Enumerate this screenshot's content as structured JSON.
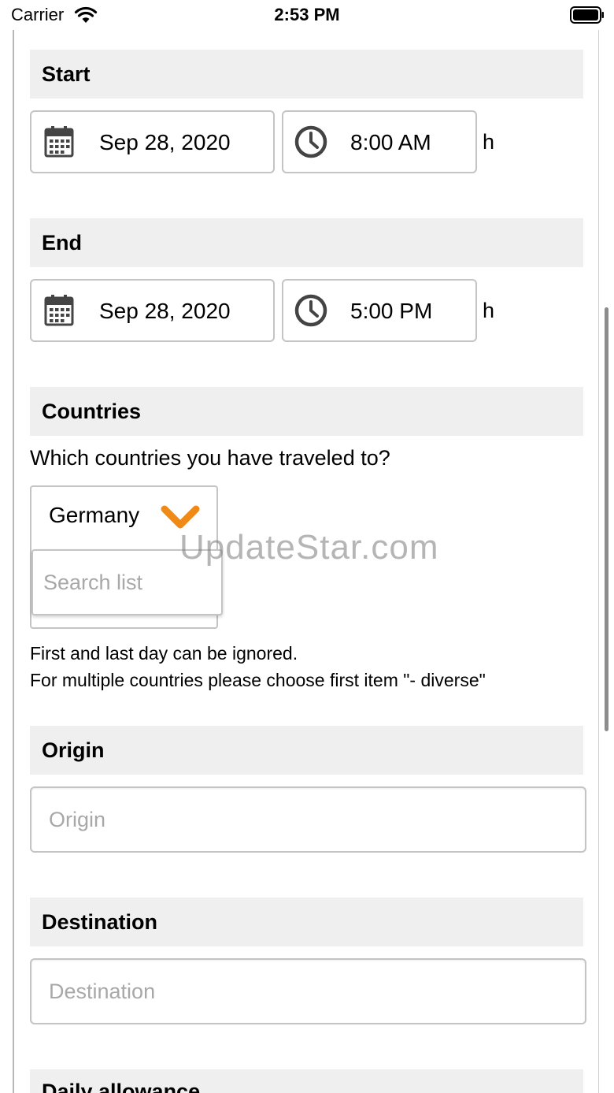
{
  "status_bar": {
    "carrier": "Carrier",
    "time": "2:53 PM"
  },
  "start": {
    "title": "Start",
    "date": "Sep 28, 2020",
    "time": "8:00 AM",
    "unit": "h"
  },
  "end": {
    "title": "End",
    "date": "Sep 28, 2020",
    "time": "5:00 PM",
    "unit": "h"
  },
  "countries": {
    "title": "Countries",
    "question": "Which countries you have traveled to?",
    "selected": "Germany",
    "search_placeholder": "Search list",
    "hint_line1": "First and last day can be ignored.",
    "hint_line2": "For multiple countries please choose first item \"- diverse\""
  },
  "origin": {
    "title": "Origin",
    "placeholder": "Origin"
  },
  "destination": {
    "title": "Destination",
    "placeholder": "Destination"
  },
  "daily_allowance": {
    "title": "Daily allowance"
  },
  "watermark": "UpdateStar.com",
  "colors": {
    "accent": "#f08a16",
    "header_bg": "#efefef",
    "border": "#c4c4c4",
    "icon": "#444444"
  }
}
